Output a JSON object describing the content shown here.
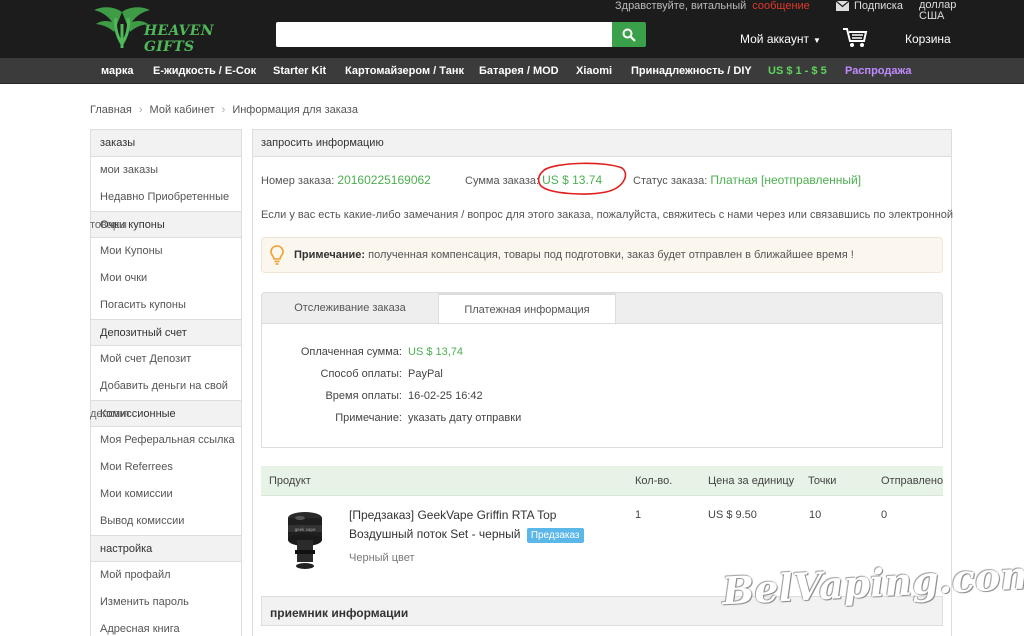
{
  "header": {
    "logo_text": "HEAVEN GIFTS",
    "search_placeholder": "",
    "greeting": "Здравствуйте, витальный",
    "register": "сообщение",
    "subscribe": "Подписка",
    "currency_line1": "доллар",
    "currency_line2": "США",
    "account": "Мой аккаунт",
    "cart": "Корзина",
    "icons": [
      "search-icon",
      "mail-icon",
      "cart-icon",
      "chevron-down-icon"
    ]
  },
  "nav": {
    "items": [
      {
        "label": "марка"
      },
      {
        "label": "Е-жидкость / Е-Сок"
      },
      {
        "label": "Starter Kit"
      },
      {
        "label": "Картомайзером / Танк"
      },
      {
        "label": "Батарея / MOD"
      },
      {
        "label": "Xiaomi"
      },
      {
        "label": "Принадлежность / DIY"
      },
      {
        "label": "US $ 1 - $ 5"
      },
      {
        "label": "Распродажа"
      }
    ],
    "colors": {
      "default": "#ffffff",
      "promo": "#5cd65c",
      "sale": "#c08bff"
    }
  },
  "breadcrumb": [
    "Главная",
    "Мой кабинет",
    "Информация для заказа"
  ],
  "sidebar": {
    "sections": [
      {
        "title": "заказы",
        "items": [
          "мои заказы",
          "Недавно Приобретенные"
        ]
      },
      {
        "title": "Очки купоны",
        "ghost": "товары",
        "items": [
          "Мои Купоны",
          "Мои очки",
          "Погасить купоны"
        ]
      },
      {
        "title": "Депозитный счет",
        "items": [
          "Мой счет Депозит",
          "Добавить деньги на свой"
        ]
      },
      {
        "title": "Комиссионные",
        "ghost": "депозит",
        "items": [
          "Моя Реферальная ссылка",
          "Мои Referrees",
          "Мои комиссии",
          "Вывод комиссии"
        ]
      },
      {
        "title": "настройка",
        "items": [
          "Мой профайл",
          "Изменить пароль",
          "Адресная книга"
        ]
      }
    ]
  },
  "main": {
    "title": "запросить информацию",
    "order_number_label": "Номер заказа:",
    "order_number": "20160225169062",
    "order_sum_label": "Сумма заказа:",
    "order_sum": "US $ 13.74",
    "status_label": "Статус заказа:",
    "status": "Платная [неотправленный]",
    "contact_text": "Если у вас есть какие-либо замечания / вопрос для этого заказа, пожалуйста, свяжитесь с нами через или связавшись по электронной",
    "note_label": "Примечание:",
    "note_text": "полученная компенсация, товары под подготовки, заказ будет отправлен в ближайшее время !",
    "tabs": [
      "Отслеживание заказа",
      "Платежная информация"
    ],
    "payment": [
      {
        "label": "Оплаченная сумма:",
        "value": "US $ 13,74"
      },
      {
        "label": "Способ оплаты:",
        "value": "PayPal"
      },
      {
        "label": "Время оплаты:",
        "value": "16-02-25 16:42"
      },
      {
        "label": "Примечание:",
        "value": "указать дату отправки"
      }
    ],
    "product_columns": [
      "Продукт",
      "Кол-во.",
      "Цена за единицу",
      "Точки",
      "Отправлено"
    ],
    "product": {
      "name": "[Предзаказ] GeekVape Griffin RTA Top Воздушный поток Set - черный",
      "badge": "Предзаказ",
      "color": "Черный цвет",
      "qty": "1",
      "price": "US $ 9.50",
      "points": "10",
      "shipped": "0"
    },
    "receiver_title": "приемник информации"
  },
  "watermark": "BelVaping.com"
}
